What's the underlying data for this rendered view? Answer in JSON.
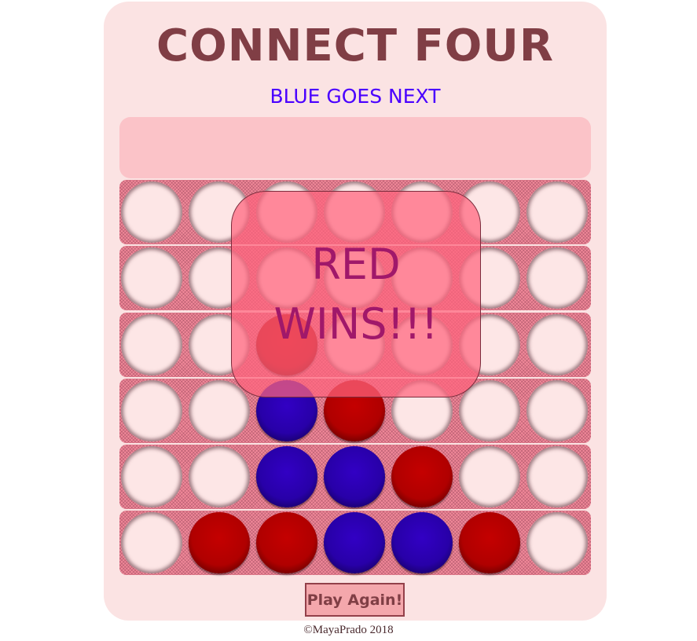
{
  "game": {
    "title": "CONNECT FOUR",
    "status": "BLUE GOES NEXT",
    "overlay_text": "RED WINS!!!",
    "play_again_label": "Play Again!",
    "footer": "©MayaPrado 2018"
  },
  "colors": {
    "title": "#803e45",
    "status": "#4a00ff",
    "panel": "#fbe3e3",
    "red_piece": "#b00000",
    "blue_piece": "#2800a8",
    "overlay_text": "#a0186a"
  },
  "board": {
    "columns": 7,
    "rows": 6,
    "cells": [
      [
        "empty",
        "empty",
        "empty",
        "empty",
        "empty",
        "empty",
        "empty"
      ],
      [
        "empty",
        "empty",
        "empty",
        "empty",
        "empty",
        "empty",
        "empty"
      ],
      [
        "empty",
        "empty",
        "red",
        "empty",
        "empty",
        "empty",
        "empty"
      ],
      [
        "empty",
        "empty",
        "blue",
        "red",
        "empty",
        "empty",
        "empty"
      ],
      [
        "empty",
        "empty",
        "blue",
        "blue",
        "red",
        "empty",
        "empty"
      ],
      [
        "empty",
        "red",
        "red",
        "blue",
        "blue",
        "red",
        "empty"
      ]
    ]
  }
}
